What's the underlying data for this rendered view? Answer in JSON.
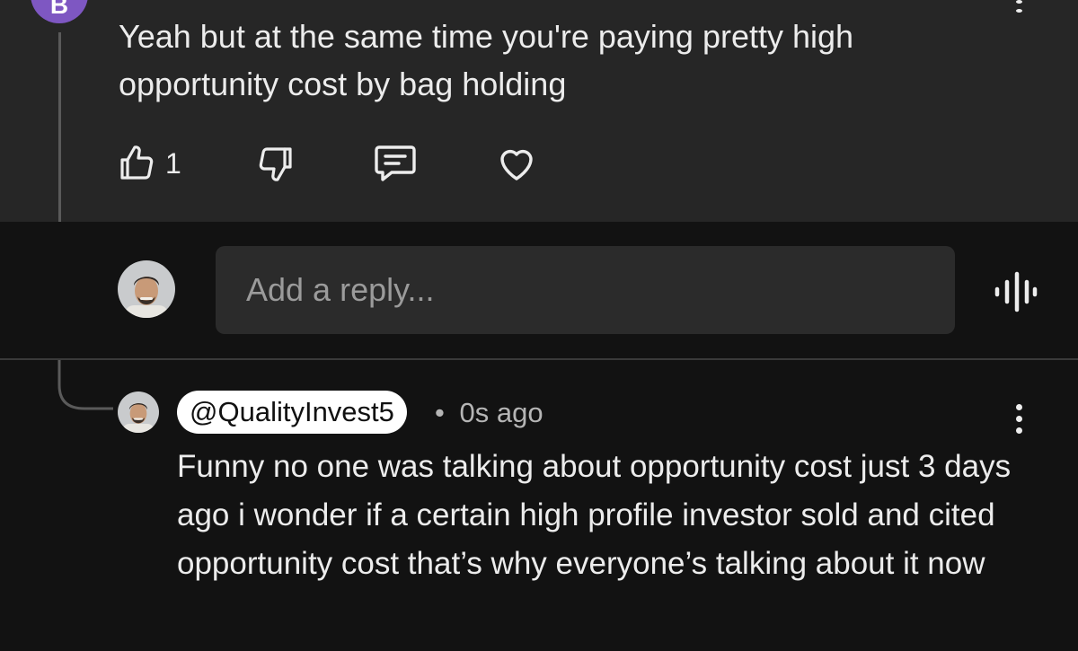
{
  "top_comment": {
    "avatar_letter": "B",
    "avatar_color": "#7e57c2",
    "text": "Yeah but at the same time you're paying pretty high opportunity cost by bag holding",
    "like_count": "1"
  },
  "reply_bar": {
    "placeholder": "Add a reply..."
  },
  "new_reply": {
    "handle": "@QualityInvest5",
    "separator": "•",
    "time": "0s ago",
    "text": "Funny no one was talking about opportunity cost just 3 days ago i wonder if a certain high profile investor sold and cited opportunity cost that’s why everyone’s talking about it now"
  },
  "colors": {
    "panel": "#262626",
    "background": "#121212",
    "input": "#2b2b2b",
    "text": "#ececec",
    "muted": "#b5b5b5"
  },
  "icons": [
    "thumbs-up-icon",
    "thumbs-down-icon",
    "comment-icon",
    "heart-icon",
    "more-vertical-icon",
    "voice-waveform-icon"
  ]
}
